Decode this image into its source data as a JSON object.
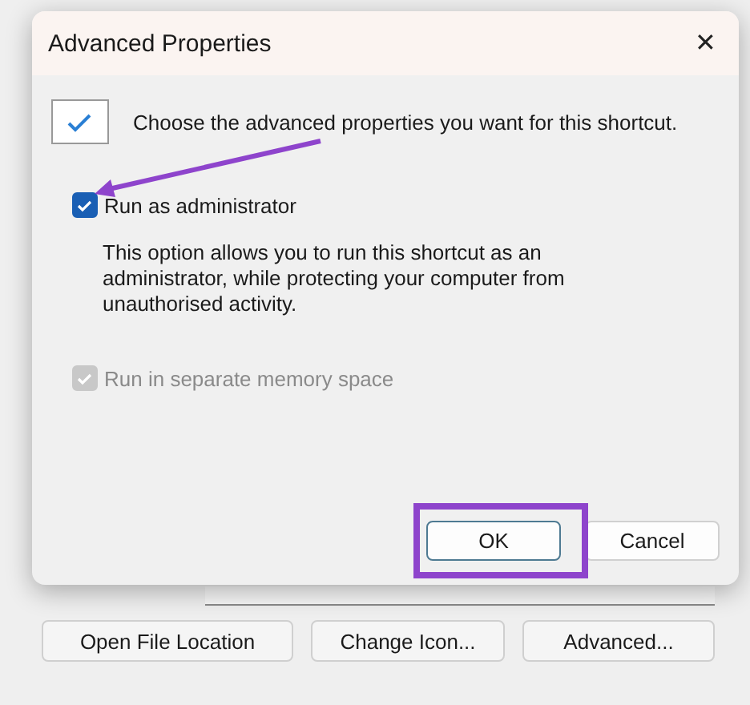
{
  "background_window": {
    "buttons": [
      "Open File Location",
      "Change Icon...",
      "Advanced..."
    ]
  },
  "dialog": {
    "title": "Advanced Properties",
    "close": "✕",
    "intro": "Choose the advanced properties you want for this shortcut.",
    "options": [
      {
        "label": "Run as administrator",
        "checked": true,
        "disabled": false,
        "description": "This option allows you to run this shortcut as an administrator, while protecting your computer from unauthorised activity."
      },
      {
        "label": "Run in separate memory space",
        "checked": true,
        "disabled": true
      }
    ],
    "buttons": [
      {
        "label": "OK",
        "default": true
      },
      {
        "label": "Cancel",
        "default": false
      }
    ]
  },
  "annotations": {
    "arrow": {
      "color": "#8e44cc"
    },
    "highlight": {
      "color": "#8e44cc"
    }
  }
}
